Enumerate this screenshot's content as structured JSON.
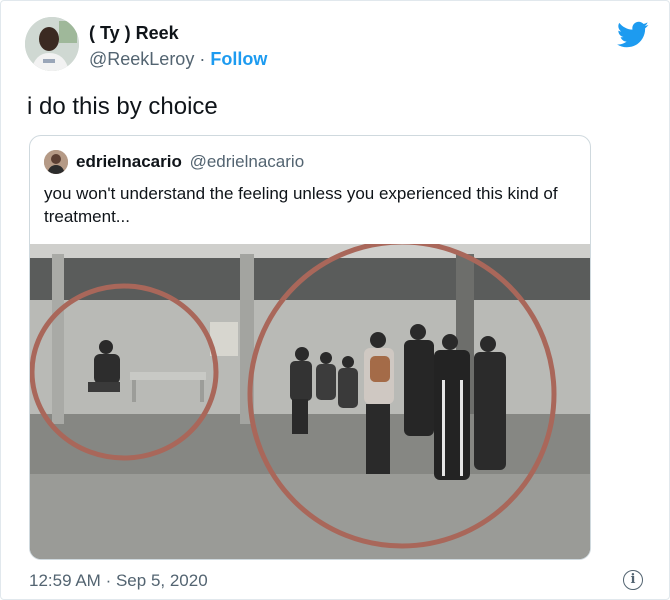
{
  "author": {
    "name": "( Ty ) Reek",
    "handle": "@ReekLeroy",
    "separator": "·",
    "follow_label": "Follow"
  },
  "tweet": {
    "text": "i do this by choice",
    "time": "12:59 AM",
    "separator": "·",
    "date": "Sep 5, 2020"
  },
  "quoted_tweet": {
    "name": "edrielnacario",
    "handle": "@edrielnacario",
    "text": "you won't understand the feeling unless you experienced this kind of treatment..."
  },
  "icons": {
    "brand": "twitter-bird-icon",
    "info": "info-icon"
  },
  "colors": {
    "accent": "#1d9bf0",
    "text": "#0f1419",
    "muted": "#536471",
    "annotation_circle": "#a9675a"
  }
}
